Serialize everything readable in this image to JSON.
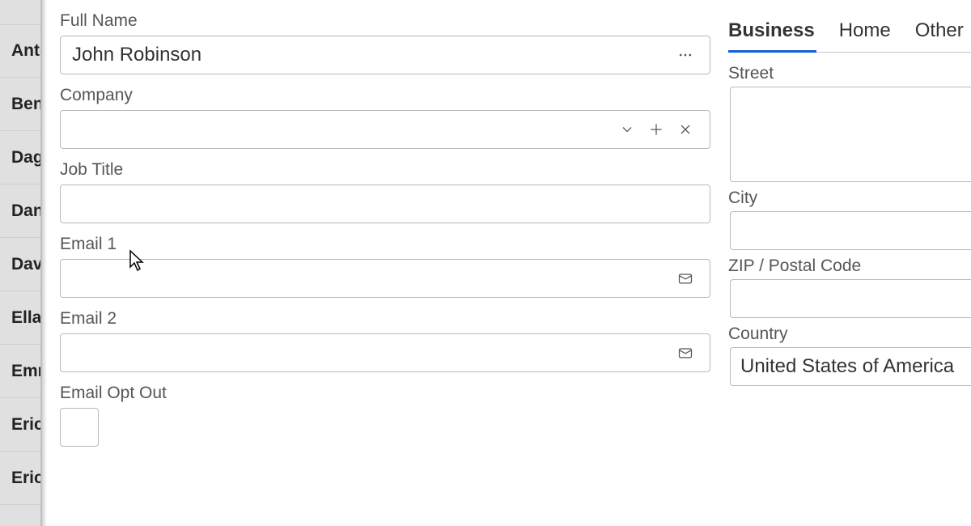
{
  "sidebar": {
    "items": [
      {
        "label": "Antonio"
      },
      {
        "label": "Benjamin"
      },
      {
        "label": "Dagmar"
      },
      {
        "label": "Daniel"
      },
      {
        "label": "David"
      },
      {
        "label": "Ella"
      },
      {
        "label": "Emma"
      },
      {
        "label": "Eric"
      },
      {
        "label": "Erich"
      }
    ]
  },
  "form": {
    "full_name_label": "Full Name",
    "full_name_value": "John Robinson",
    "company_label": "Company",
    "company_value": "",
    "job_title_label": "Job Title",
    "job_title_value": "",
    "email1_label": "Email 1",
    "email1_value": "",
    "email2_label": "Email 2",
    "email2_value": "",
    "email_opt_out_label": "Email Opt Out",
    "email_opt_out_checked": false
  },
  "address": {
    "tabs": [
      {
        "label": "Business",
        "active": true
      },
      {
        "label": "Home",
        "active": false
      },
      {
        "label": "Other",
        "active": false
      }
    ],
    "street_label": "Street",
    "street_value": "",
    "city_label": "City",
    "city_value": "",
    "zip_label": "ZIP / Postal Code",
    "zip_value": "",
    "country_label": "Country",
    "country_value": "United States of America"
  },
  "icons": {
    "more": "more-horizontal-icon",
    "chevron_down": "chevron-down-icon",
    "plus": "plus-icon",
    "x": "close-icon",
    "mail": "mail-icon"
  }
}
